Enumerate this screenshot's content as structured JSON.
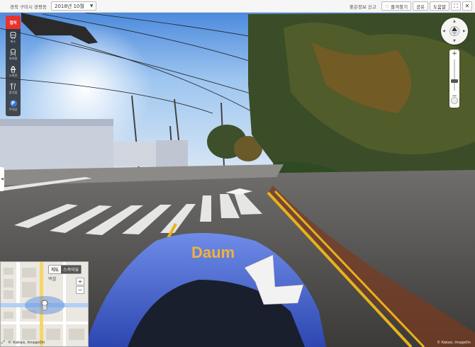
{
  "topbar": {
    "location": "경북 구미시 광평동",
    "date_select": "2018년 10월",
    "report_link": "좋은정보 신고",
    "favorite_label": "즐겨찾기",
    "share_label": "공유",
    "help_label": "도움말"
  },
  "sidebar": {
    "brand": "캡처",
    "items": [
      {
        "label": "버스",
        "icon": "bus-icon"
      },
      {
        "label": "지하철",
        "icon": "subway-icon"
      },
      {
        "label": "소화전",
        "icon": "hydrant-icon"
      },
      {
        "label": "음식점",
        "icon": "restaurant-icon"
      },
      {
        "label": "주차장",
        "icon": "parking-icon",
        "glyph": "P"
      }
    ]
  },
  "minimap": {
    "tab_map": "지도",
    "tab_sky": "스카이뷰",
    "place": "백셀",
    "zoom_in": "+",
    "zoom_out": "−",
    "copyright": "© Kakao, ImageOn"
  },
  "footer": {
    "copyright": "© Kakao, ImageOn"
  },
  "colors": {
    "brand_red": "#e8322e",
    "parking_blue": "#3a78d8",
    "vehicle_blue": "#4a6fd8"
  }
}
